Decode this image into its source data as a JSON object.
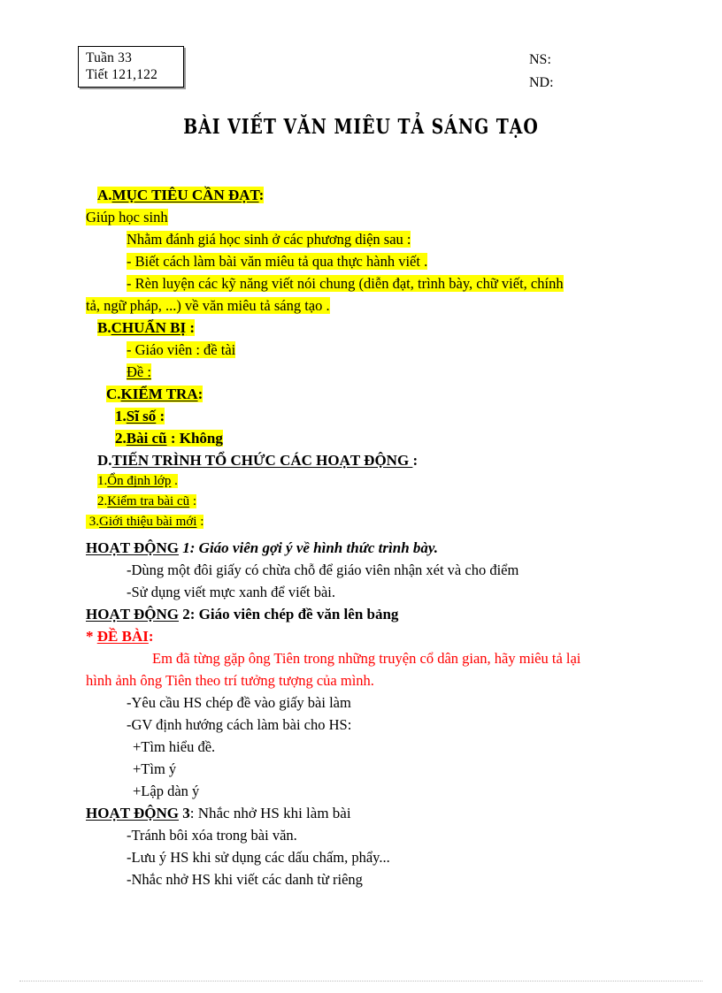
{
  "header": {
    "week_box": {
      "line1": "Tuần 33",
      "line2": "Tiết 121,122"
    },
    "ns_label": "NS:",
    "nd_label": "ND:"
  },
  "title": "BÀI VIẾT VĂN MIÊU TẢ SÁNG TẠO",
  "colors": {
    "highlight": "#FFFF00",
    "red_text": "#FF0000",
    "text": "#000000",
    "page_background": "#FFFFFF"
  },
  "sections": {
    "a": {
      "label": "A.",
      "heading": "MỤC TIÊU CẦN ĐẠT",
      "colon": ":",
      "lines": [
        "Giúp học sinh",
        "Nhằm đánh giá học sinh ở các phương diện sau :",
        "- Biết cách làm bài văn miêu tả qua thực hành viết .",
        "- Rèn luyện các kỹ năng viết nói chung (diễn đạt, trình bày, chữ viết, chính",
        "tả, ngữ pháp, ...) về văn miêu tả sáng tạo ."
      ]
    },
    "b": {
      "label": "B.",
      "heading": "CHUẨN BỊ",
      "colon": " :",
      "lines": [
        "- Giáo viên : đề tài",
        "Đề :"
      ]
    },
    "c": {
      "label": "C.",
      "heading": "KIỂM TRA",
      "colon": ":",
      "items": [
        {
          "num": "1.",
          "label": "Sĩ số",
          "colon": " :",
          "value": ""
        },
        {
          "num": "2.",
          "label": "Bài cũ",
          "colon": " :",
          "value": " Không"
        }
      ]
    },
    "d": {
      "label": "D.",
      "heading": "TIẾN TRÌNH TỔ CHỨC CÁC HOẠT ĐỘNG ",
      "colon": ":",
      "items": [
        {
          "num": "1.",
          "label": "Ổn định lớp",
          "trail": " ."
        },
        {
          "num": "2.",
          "label": "Kiểm tra bài cũ",
          "trail": " :"
        },
        {
          "num": "3.",
          "label": "Giới thiệu bài mới",
          "trail": " :"
        }
      ]
    }
  },
  "activities": [
    {
      "head": "HOẠT ĐỘNG",
      "num": " 1",
      "rest": ": Giáo viên gợi ý về hình thức trình bày.",
      "bullets": [
        "-Dùng một đôi giấy có chừa chỗ để giáo viên nhận xét và cho điểm",
        "-Sử dụng viết mực xanh để viết bài."
      ]
    },
    {
      "head": "HOẠT ĐỘNG",
      "num": " 2",
      "rest": ": Giáo viên chép đề văn lên bảng",
      "bullets": []
    },
    {
      "head": "HOẠT ĐỘNG",
      "num": " 3",
      "rest": ": Nhắc nhở HS khi làm bài",
      "bullets": [
        "-Tránh bôi xóa trong bài văn.",
        "-Lưu ý HS khi sử dụng các dấu chấm, phẩy...",
        "-Nhắc nhở HS khi viết các danh từ riêng"
      ]
    }
  ],
  "de_bai": {
    "star": "* ",
    "label": "ĐỀ BÀI",
    "colon": ":",
    "paragraph_line1": "Em đã từng gặp ông Tiên trong những truyện cổ dân gian, hãy miêu tả lại",
    "paragraph_line2": "hình ảnh ông Tiên theo trí tưởng tượng của mình."
  },
  "guidance": [
    "-Yêu cầu HS chép đề vào giấy bài làm",
    "-GV định hướng cách làm bài cho HS:",
    "+Tìm hiểu đề.",
    "+Tìm ý",
    "+Lập dàn ý"
  ]
}
